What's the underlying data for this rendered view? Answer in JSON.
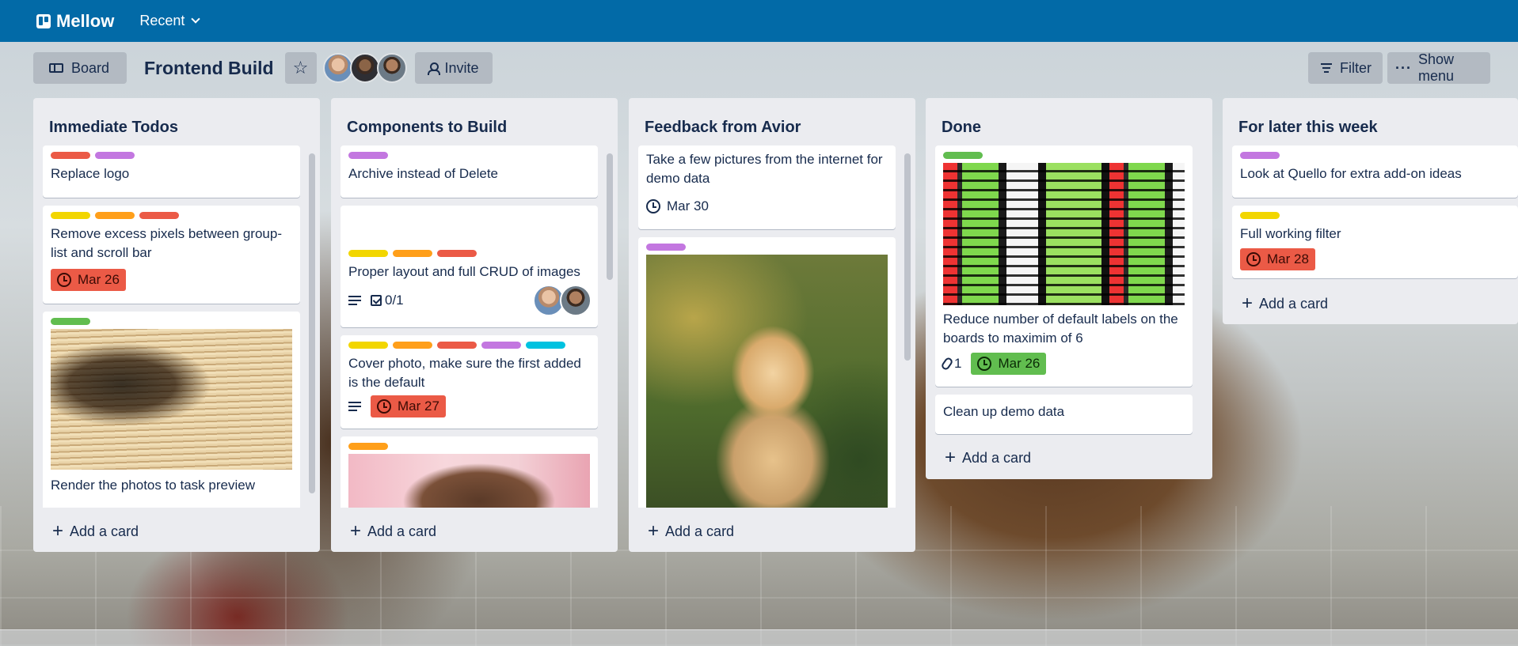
{
  "app": {
    "brand": "Mellow",
    "recent": "Recent"
  },
  "board": {
    "view_label": "Board",
    "title": "Frontend Build",
    "invite": "Invite",
    "filter": "Filter",
    "show_menu": "Show menu"
  },
  "colors": {
    "nav": "#026aa7",
    "label_red": "#eb5a46",
    "label_purple": "#c377e0",
    "label_yellow": "#f2d600",
    "label_orange": "#ff9f1a",
    "label_green": "#61bd4f",
    "label_sky": "#00c2e0"
  },
  "add_card": "Add a card",
  "lists": [
    {
      "title": "Immediate Todos",
      "cards": [
        {
          "text": "Replace logo",
          "labels": [
            "red",
            "purple"
          ]
        },
        {
          "text": "Remove excess pixels between group-list and scroll bar",
          "labels": [
            "yellow",
            "orange",
            "red"
          ],
          "due": "Mar 26",
          "due_status": "overdue"
        },
        {
          "text": "Render the photos to task preview",
          "labels": [
            "green"
          ],
          "cover": "books-image"
        }
      ]
    },
    {
      "title": "Components to Build",
      "cards": [
        {
          "text": "Archive instead of Delete",
          "labels": [
            "purple"
          ]
        },
        {
          "text": "Proper layout and full CRUD of images",
          "labels": [
            "yellow",
            "orange",
            "red"
          ],
          "checklist": "0/1"
        },
        {
          "text": "Cover photo, make sure the first added is the default",
          "labels": [
            "yellow",
            "orange",
            "red",
            "purple",
            "sky"
          ],
          "due": "Mar 27",
          "due_status": "overdue"
        },
        {
          "text": "",
          "labels": [
            "orange"
          ],
          "cover": "portrait-image"
        }
      ]
    },
    {
      "title": "Feedback from Avior",
      "cards": [
        {
          "text": "Take a few pictures from the internet for demo data",
          "due": "Mar 30",
          "due_status": "upcoming"
        },
        {
          "text": "",
          "labels": [
            "purple"
          ],
          "cover": "dog-image"
        }
      ]
    },
    {
      "title": "Done",
      "cards": [
        {
          "text": "Reduce number of default labels on the boards to maximim of 6",
          "labels": [
            "green"
          ],
          "cover": "code-image",
          "attachments": "1",
          "due": "Mar 26",
          "due_status": "complete"
        },
        {
          "text": "Clean up demo data"
        }
      ]
    },
    {
      "title": "For later this week",
      "cards": [
        {
          "text": "Look at Quello for extra add-on ideas",
          "labels": [
            "purple"
          ]
        },
        {
          "text": "Full working filter",
          "labels": [
            "yellow"
          ],
          "due": "Mar 28",
          "due_status": "overdue"
        }
      ]
    }
  ]
}
